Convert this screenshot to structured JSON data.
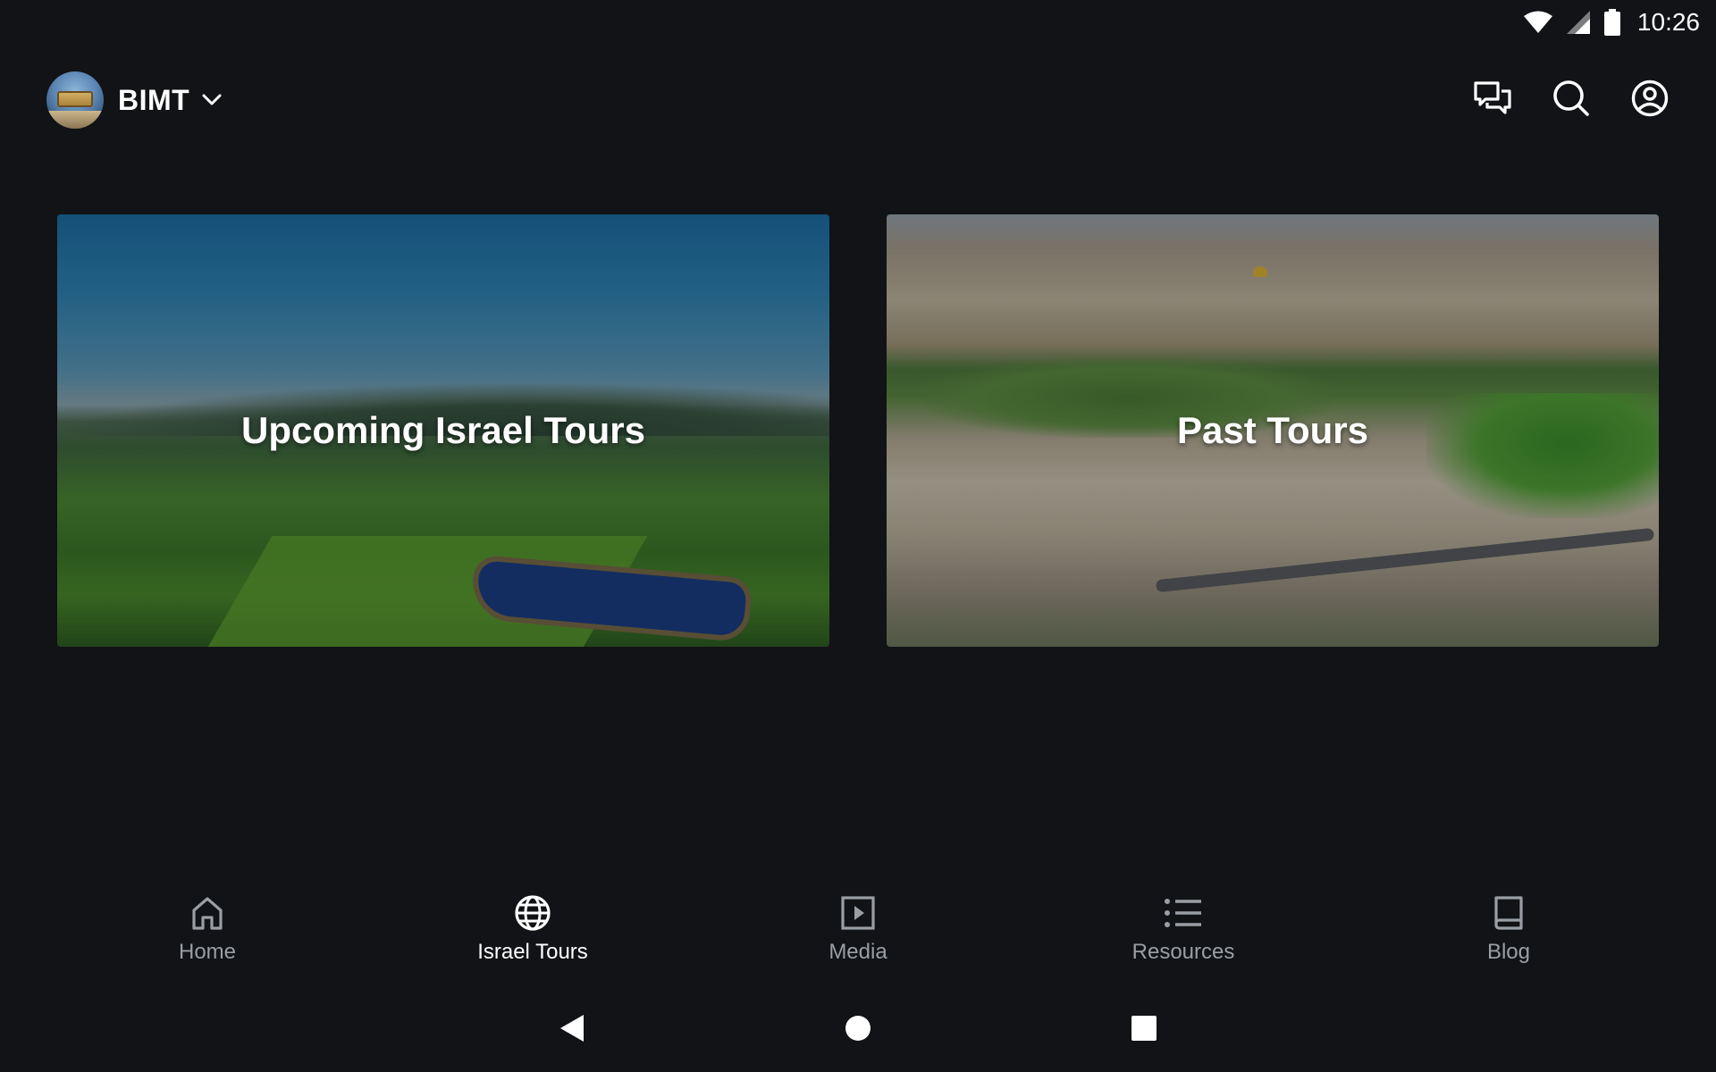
{
  "status_bar": {
    "time": "10:26",
    "icons": [
      "wifi-icon",
      "cell-signal-icon",
      "battery-icon"
    ]
  },
  "app_bar": {
    "org_name": "BIMT",
    "avatar": "bimt-logo-avatar",
    "actions": [
      "chat-icon",
      "search-icon",
      "account-icon"
    ]
  },
  "cards": [
    {
      "title": "Upcoming Israel Tours",
      "image": "valley-landscape"
    },
    {
      "title": "Past Tours",
      "image": "jerusalem-aerial"
    }
  ],
  "bottom_nav": {
    "items": [
      {
        "label": "Home",
        "icon": "home-icon",
        "active": false
      },
      {
        "label": "Israel Tours",
        "icon": "globe-icon",
        "active": true
      },
      {
        "label": "Media",
        "icon": "play-icon",
        "active": false
      },
      {
        "label": "Resources",
        "icon": "list-icon",
        "active": false
      },
      {
        "label": "Blog",
        "icon": "book-icon",
        "active": false
      }
    ]
  },
  "colors": {
    "background": "#111316",
    "active_nav": "#ffffff",
    "inactive_nav": "#9a9ea5"
  }
}
